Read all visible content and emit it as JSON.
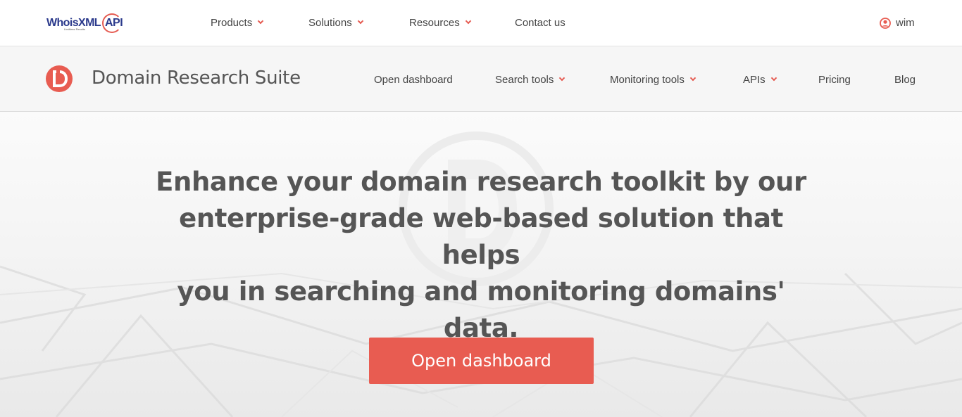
{
  "brand": {
    "name_main": "WhoisXML",
    "name_api": "API",
    "tagline": "Limitless Results"
  },
  "top_nav": {
    "items": [
      {
        "label": "Products",
        "has_dropdown": true
      },
      {
        "label": "Solutions",
        "has_dropdown": true
      },
      {
        "label": "Resources",
        "has_dropdown": true
      },
      {
        "label": "Contact us",
        "has_dropdown": false
      }
    ],
    "user": {
      "name": "wim",
      "icon": "user-circle-icon"
    }
  },
  "suite_nav": {
    "title": "Domain Research Suite",
    "logo_icon": "drs-logo-icon",
    "items": [
      {
        "label": "Open dashboard",
        "has_dropdown": false
      },
      {
        "label": "Search tools",
        "has_dropdown": true
      },
      {
        "label": "Monitoring tools",
        "has_dropdown": true
      },
      {
        "label": "APIs",
        "has_dropdown": true
      },
      {
        "label": "Pricing",
        "has_dropdown": false
      },
      {
        "label": "Blog",
        "has_dropdown": false
      }
    ]
  },
  "hero": {
    "lines": [
      "Enhance your domain research toolkit by our",
      "enterprise-grade web-based solution that helps",
      "you in searching and monitoring domains' data."
    ],
    "cta_label": "Open dashboard"
  },
  "colors": {
    "accent": "#e85c51",
    "brand_blue": "#2b3a8c",
    "text": "#444444",
    "subbar_bg": "#f6f6f6"
  }
}
